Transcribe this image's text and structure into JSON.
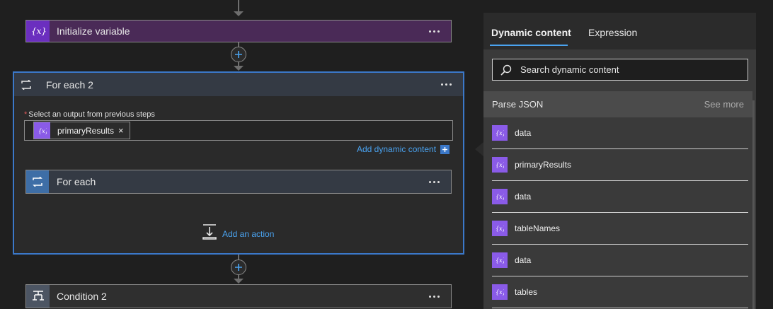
{
  "flow": {
    "init_variable": {
      "title": "Initialize variable",
      "icon": "variable-icon",
      "color": "#5b2a73"
    },
    "for_each_2": {
      "title": "For each 2",
      "field_label": "Select an output from previous steps",
      "token": {
        "label": "primaryResults",
        "close": "×"
      },
      "add_dynamic_content": "Add dynamic content",
      "inner_for_each": {
        "title": "For each"
      },
      "add_action": "Add an action",
      "accent": "#3b78c9"
    },
    "condition": {
      "title": "Condition 2",
      "icon": "condition-icon"
    }
  },
  "panel": {
    "tabs": [
      {
        "label": "Dynamic content",
        "active": true
      },
      {
        "label": "Expression",
        "active": false
      }
    ],
    "search": {
      "placeholder": "Search dynamic content"
    },
    "section": {
      "title": "Parse JSON",
      "see_more": "See more"
    },
    "items": [
      {
        "label": "data"
      },
      {
        "label": "primaryResults"
      },
      {
        "label": "data"
      },
      {
        "label": "tableNames"
      },
      {
        "label": "data"
      },
      {
        "label": "tables"
      }
    ],
    "token_color": "#8a5be8"
  }
}
